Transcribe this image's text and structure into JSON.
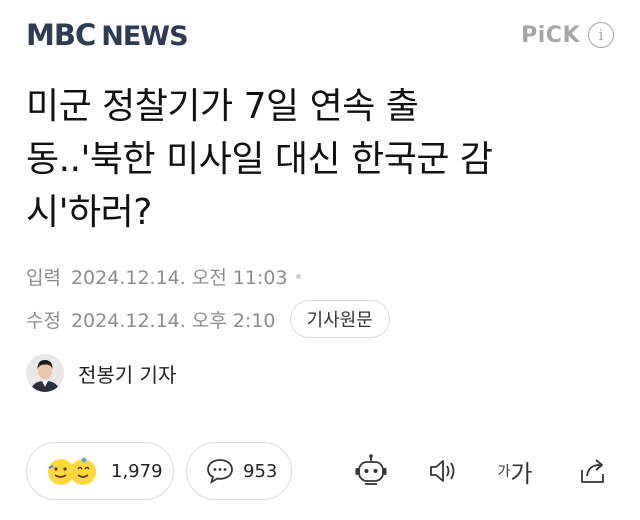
{
  "header": {
    "logo_mbc": "MBC",
    "logo_news": "NEWS",
    "pick_label": "PiCK",
    "info_icon_glyph": "i"
  },
  "article": {
    "title_lines": [
      "미군 정찰기가 7일 연속 출",
      "동..'북한 미사일 대신 한국군 감",
      "시'하러?"
    ],
    "published_label": "입력",
    "published_time": "2024.12.14. 오전 11:03",
    "modified_label": "수정",
    "modified_time": "2024.12.14. 오후 2:10",
    "original_button": "기사원문",
    "reporter": "전봉기 기자"
  },
  "actions": {
    "like_count": "1,979",
    "comment_count": "953",
    "font_small": "가",
    "font_big": "가"
  },
  "colors": {
    "logo": "#2f3b52",
    "muted": "#8c8c8c",
    "pick": "#a6a6a6"
  },
  "icons": [
    "robot-icon",
    "speaker-icon",
    "font-size-icon",
    "share-icon",
    "reaction-emoji-icon",
    "comment-icon",
    "info-icon"
  ]
}
